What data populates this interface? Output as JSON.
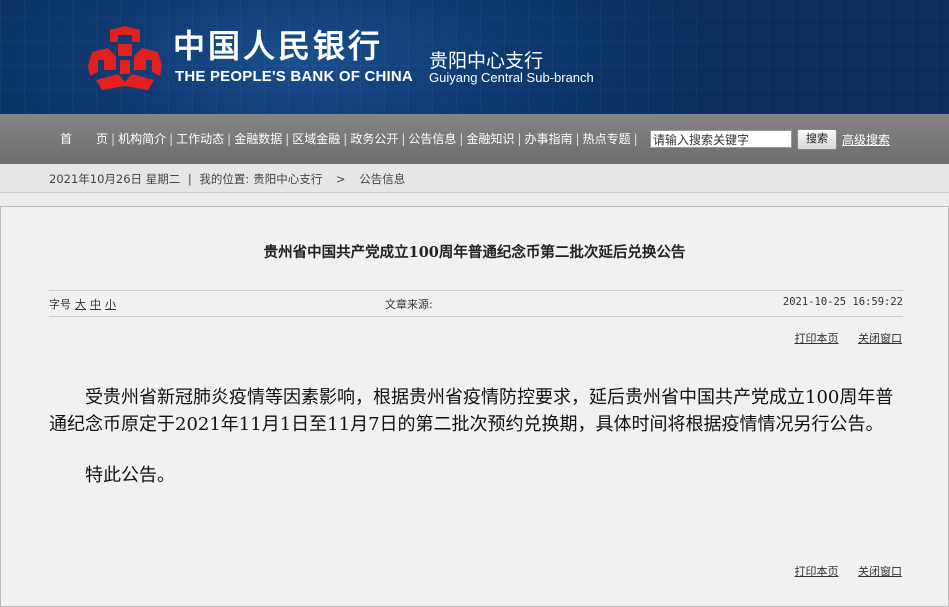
{
  "header": {
    "bank_name_cn": "中国人民银行",
    "bank_name_en": "THE PEOPLE'S BANK OF CHINA",
    "branch_cn": "贵阳中心支行",
    "branch_en": "Guiyang  Central Sub-branch",
    "logo_icon": "pboc-logo-icon",
    "logo_color": "#e32020",
    "bg_color": "#0f3a72"
  },
  "nav": {
    "items": [
      "首　　页",
      "机构简介",
      "工作动态",
      "金融数据",
      "区域金融",
      "政务公开",
      "公告信息",
      "金融知识",
      "办事指南",
      "热点专题"
    ],
    "separator": "|",
    "search_placeholder": "请输入搜索关键字",
    "search_button": "搜索",
    "advanced_search": "高级搜索"
  },
  "breadcrumb": {
    "date": "2021年10月26日  星期二",
    "sep": "|",
    "location_label": "我的位置:",
    "path": [
      "贵阳中心支行",
      "公告信息"
    ],
    "arrow": ">"
  },
  "article": {
    "title": "贵州省中国共产党成立100周年普通纪念币第二批次延后兑换公告",
    "font_size_label": "字号",
    "font_sizes": [
      "大",
      "中",
      "小"
    ],
    "source_label": "文章来源:",
    "datetime": "2021-10-25 16:59:22",
    "print_label": "打印本页",
    "close_label": "关闭窗口",
    "paragraphs": [
      "受贵州省新冠肺炎疫情等因素影响，根据贵州省疫情防控要求，延后贵州省中国共产党成立100周年普通纪念币原定于2021年11月1日至11月7日的第二批次预约兑换期，具体时间将根据疫情情况另行公告。",
      "特此公告。"
    ]
  }
}
